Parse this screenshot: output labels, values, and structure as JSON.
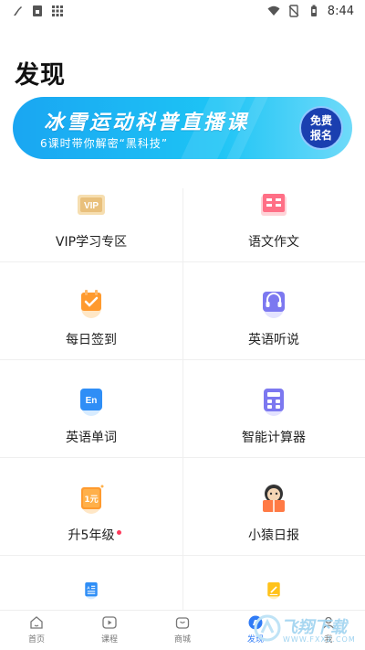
{
  "status_bar": {
    "time": "8:44"
  },
  "page": {
    "title": "发现"
  },
  "banner": {
    "title": "冰雪运动科普直播课",
    "subtitle": "6课时带你解密“黑科技”",
    "badge_line1": "免费",
    "badge_line2": "报名"
  },
  "grid": [
    {
      "label": "VIP学习专区",
      "icon": "vip-card-icon",
      "dot": false
    },
    {
      "label": "语文作文",
      "icon": "chinese-book-icon",
      "dot": false
    },
    {
      "label": "每日签到",
      "icon": "calendar-check-icon",
      "dot": false
    },
    {
      "label": "英语听说",
      "icon": "headset-icon",
      "dot": false
    },
    {
      "label": "英语单词",
      "icon": "english-card-icon",
      "dot": false
    },
    {
      "label": "智能计算器",
      "icon": "calculator-icon",
      "dot": false
    },
    {
      "label": "升5年级",
      "icon": "one-yuan-icon",
      "dot": true
    },
    {
      "label": "小猿日报",
      "icon": "monkey-reading-icon",
      "dot": false
    },
    {
      "label": "",
      "icon": "dictionary-icon",
      "dot": false
    },
    {
      "label": "",
      "icon": "pencil-book-icon",
      "dot": false
    }
  ],
  "grid_icon_extra": {
    "one_yuan_text": "1元",
    "english_text": "En"
  },
  "bottom_nav": [
    {
      "label": "首页",
      "icon": "home-icon",
      "active": false
    },
    {
      "label": "课程",
      "icon": "play-icon",
      "active": false
    },
    {
      "label": "商城",
      "icon": "shop-icon",
      "active": false
    },
    {
      "label": "发现",
      "icon": "discover-icon",
      "active": true
    },
    {
      "label": "我",
      "icon": "profile-icon",
      "active": false
    }
  ],
  "watermark": {
    "text": "飞翔下载",
    "url": "WWW.FXXZ.COM"
  },
  "colors": {
    "accent": "#2f7bf6",
    "banner_start": "#1aa6f2",
    "banner_end": "#6fdaf9",
    "dot": "#ff3b5c"
  }
}
